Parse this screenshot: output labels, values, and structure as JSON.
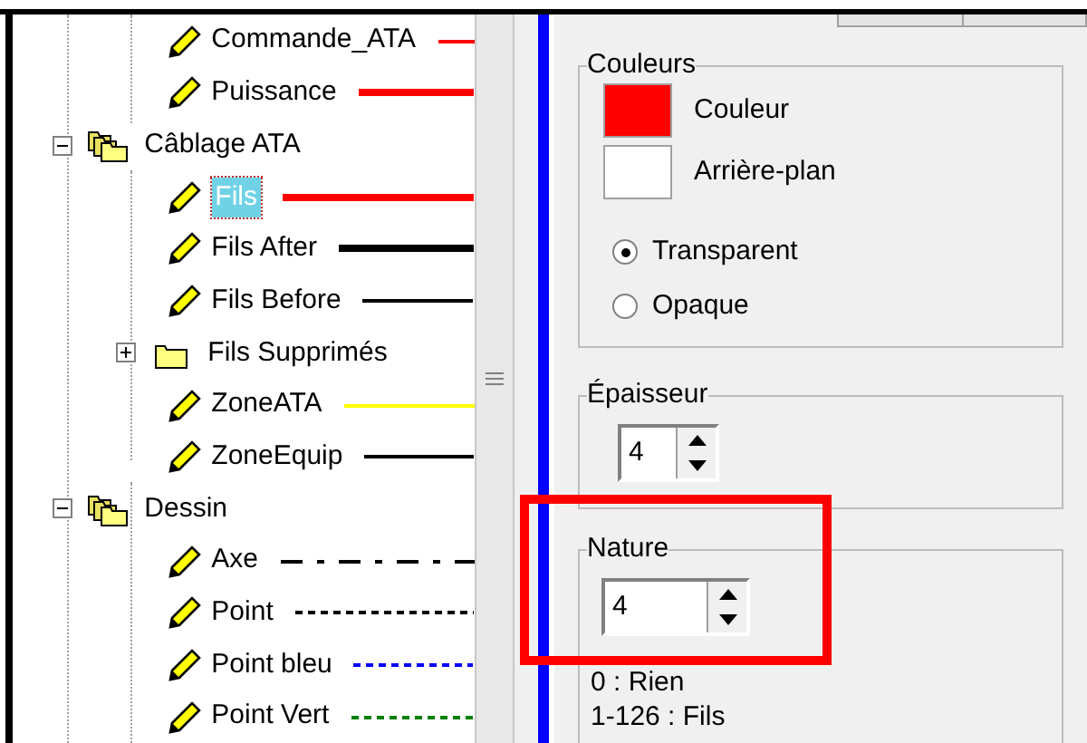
{
  "tree": [
    {
      "children": [
        {
          "kind": "layer",
          "label": "Commande_ATA",
          "selected": false,
          "line": {
            "kind": "thin",
            "color": "#ff0000"
          }
        },
        {
          "kind": "layer",
          "label": "Puissance",
          "selected": false,
          "line": {
            "kind": "thick",
            "color": "#ff0000"
          }
        }
      ]
    },
    {
      "kind": "folder",
      "label": "Câblage ATA",
      "expanded": true,
      "children": [
        {
          "kind": "layer",
          "label": "Fils",
          "selected": true,
          "line": {
            "kind": "thick",
            "color": "#ff0000"
          }
        },
        {
          "kind": "layer",
          "label": "Fils After",
          "selected": false,
          "line": {
            "kind": "thick",
            "color": "#000000"
          }
        },
        {
          "kind": "layer",
          "label": "Fils Before",
          "selected": false,
          "line": {
            "kind": "thin",
            "color": "#000000"
          }
        },
        {
          "kind": "folder",
          "label": "Fils Supprimés",
          "expanded": false
        },
        {
          "kind": "layer",
          "label": "ZoneATA",
          "selected": false,
          "line": {
            "kind": "thin",
            "color": "#ffff00"
          }
        },
        {
          "kind": "layer",
          "label": "ZoneEquip",
          "selected": false,
          "line": {
            "kind": "thin",
            "color": "#000000"
          }
        }
      ]
    },
    {
      "kind": "folder",
      "label": "Dessin",
      "expanded": true,
      "children": [
        {
          "kind": "layer",
          "label": "Axe",
          "selected": false,
          "line": {
            "kind": "dashdot",
            "color": "#000000"
          }
        },
        {
          "kind": "layer",
          "label": "Point",
          "selected": false,
          "line": {
            "kind": "dashed",
            "color": "#000000"
          }
        },
        {
          "kind": "layer",
          "label": "Point bleu",
          "selected": false,
          "line": {
            "kind": "dashed",
            "color": "#0000ff"
          }
        },
        {
          "kind": "layer",
          "label": "Point Vert",
          "selected": false,
          "line": {
            "kind": "dashed",
            "color": "#008000"
          }
        }
      ]
    }
  ],
  "colors": {
    "title": "Couleurs",
    "swatches": [
      {
        "label": "Couleur",
        "color": "#ff0000"
      },
      {
        "label": "Arrière-plan",
        "color": "#ffffff"
      }
    ],
    "options": [
      {
        "label": "Transparent",
        "selected": true
      },
      {
        "label": "Opaque",
        "selected": false
      }
    ]
  },
  "thickness": {
    "title": "Épaisseur",
    "value": "4"
  },
  "nature": {
    "title": "Nature",
    "value": "4",
    "legend": [
      "0 : Rien",
      "1-126 : Fils"
    ]
  }
}
